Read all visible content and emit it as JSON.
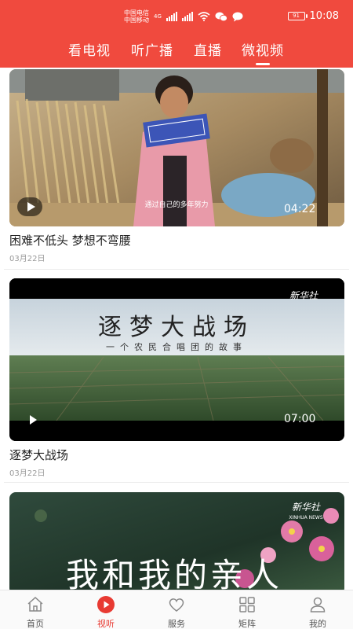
{
  "statusbar": {
    "carrier1": "中国电信",
    "carrier2": "中国移动",
    "network": "4G",
    "battery": "91",
    "time": "10:08"
  },
  "tabs": [
    {
      "label": "看电视"
    },
    {
      "label": "听广播"
    },
    {
      "label": "直播"
    },
    {
      "label": "微视频",
      "active": true
    }
  ],
  "feed": [
    {
      "title": "困难不低头 梦想不弯腰",
      "date": "03月22日",
      "duration": "04:22",
      "caption": "通过自己的多年努力"
    },
    {
      "title": "逐梦大战场",
      "date": "03月22日",
      "duration": "07:00",
      "watermark": "新华社",
      "overlay_title": "逐梦大战场",
      "overlay_subtitle": "一个农民合唱团的故事"
    },
    {
      "watermark": "新华社",
      "watermark_sub": "XINHUA NEWS",
      "overlay_title": "我和我的亲人"
    }
  ],
  "bottom_nav": [
    {
      "label": "首页",
      "icon": "home-icon"
    },
    {
      "label": "视听",
      "icon": "play-circle-icon",
      "active": true
    },
    {
      "label": "服务",
      "icon": "heart-icon"
    },
    {
      "label": "矩阵",
      "icon": "grid-icon"
    },
    {
      "label": "我的",
      "icon": "user-icon"
    }
  ],
  "colors": {
    "brand_red": "#f04a3e",
    "active_nav": "#e83a32"
  }
}
